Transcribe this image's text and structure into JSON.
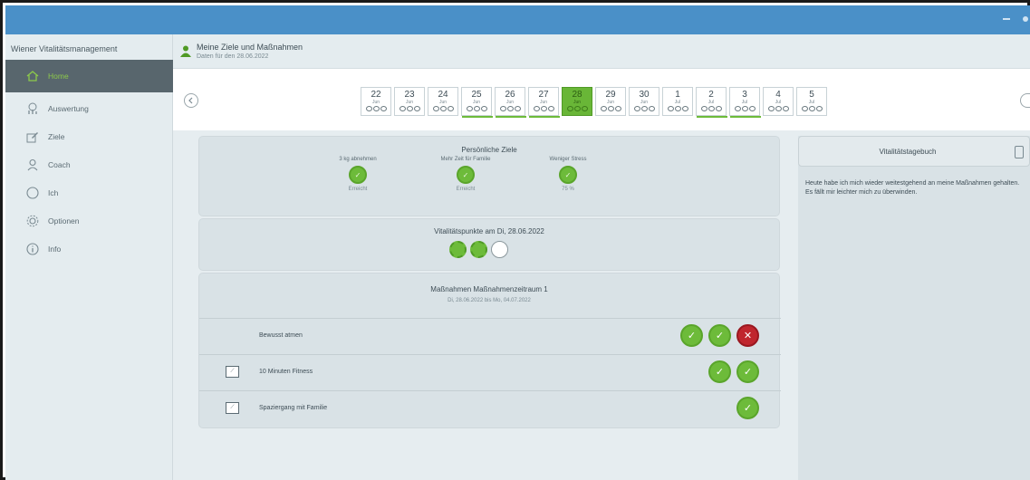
{
  "app": {
    "title": "Wiener Vitalitätsmanagement"
  },
  "nav": {
    "items": [
      {
        "label": "Home",
        "icon": "home-icon",
        "active": true
      },
      {
        "label": "Auswertung",
        "icon": "chart-icon"
      },
      {
        "label": "Ziele",
        "icon": "pencil-icon"
      },
      {
        "label": "Coach",
        "icon": "person-icon"
      },
      {
        "label": "Ich",
        "icon": "face-icon"
      },
      {
        "label": "Optionen",
        "icon": "gear-icon"
      },
      {
        "label": "Info",
        "icon": "info-icon"
      }
    ]
  },
  "header": {
    "title": "Meine Ziele und Maßnahmen",
    "subtitle": "Daten für den 28.06.2022"
  },
  "dates": [
    {
      "day": "22",
      "month": "Jun"
    },
    {
      "day": "23",
      "month": "Jun"
    },
    {
      "day": "24",
      "month": "Jun"
    },
    {
      "day": "25",
      "month": "Jun",
      "underline": true
    },
    {
      "day": "26",
      "month": "Jun",
      "underline": true
    },
    {
      "day": "27",
      "month": "Jun",
      "underline": true
    },
    {
      "day": "28",
      "month": "Jun",
      "selected": true
    },
    {
      "day": "29",
      "month": "Jun"
    },
    {
      "day": "30",
      "month": "Jun"
    },
    {
      "day": "1",
      "month": "Jul"
    },
    {
      "day": "2",
      "month": "Jul",
      "underline": true
    },
    {
      "day": "3",
      "month": "Jul",
      "underline": true
    },
    {
      "day": "4",
      "month": "Jul"
    },
    {
      "day": "5",
      "month": "Jul"
    }
  ],
  "goals": {
    "title": "Persönliche Ziele",
    "items": [
      {
        "label": "3 kg abnehmen",
        "status": "Erreicht"
      },
      {
        "label": "Mehr Zeit für Familie",
        "status": "Erreicht"
      },
      {
        "label": "Weniger Stress",
        "status": "75 %"
      }
    ]
  },
  "vital": {
    "title": "Vitalitätspunkte am Di, 28.06.2022",
    "points_earned": 2,
    "points_total": 3
  },
  "measures": {
    "title": "Maßnahmen Maßnahmenzeitraum 1",
    "subtitle": "Di, 28.06.2022 bis Mo, 04.07.2022",
    "rows": [
      {
        "label": "Bewusst atmen",
        "has_icon": false,
        "marks": [
          "ok",
          "ok",
          "fail"
        ]
      },
      {
        "label": "10 Minuten Fitness",
        "has_icon": true,
        "marks": [
          "ok",
          "ok"
        ]
      },
      {
        "label": "Spaziergang mit Familie",
        "has_icon": true,
        "marks": [
          "ok"
        ]
      }
    ]
  },
  "diary": {
    "title": "Vitalitätstagebuch",
    "text": "Heute habe ich mich wieder weitestgehend an meine Maßnahmen gehalten. Es fällt mir leichter mich zu überwinden."
  },
  "colors": {
    "accent": "#6dbb3a",
    "fail": "#c0262e",
    "titlebar": "#4a90c8",
    "sidebar_active": "#58666d"
  }
}
